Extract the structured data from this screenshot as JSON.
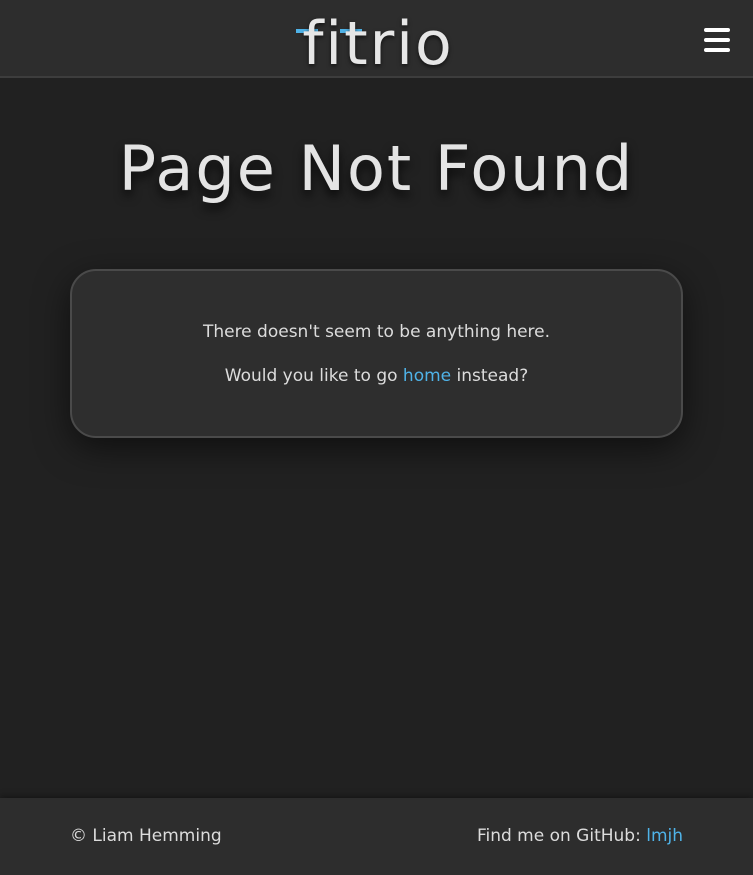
{
  "header": {
    "logo_text": "fitrio",
    "menu_icon": "hamburger-menu-icon"
  },
  "main": {
    "title": "Page Not Found",
    "message_line1": "There doesn't seem to be anything here.",
    "message_line2_prefix": "Would you like to go ",
    "home_link_label": "home",
    "message_line2_suffix": " instead?"
  },
  "footer": {
    "copyright": "© Liam Hemming",
    "github_prefix": "Find me on GitHub: ",
    "github_link_label": "lmjh"
  },
  "colors": {
    "background": "#212121",
    "header_footer": "#2d2d2d",
    "card": "#2e2e2e",
    "accent": "#4fb3e8",
    "text": "#dcdcdc"
  }
}
